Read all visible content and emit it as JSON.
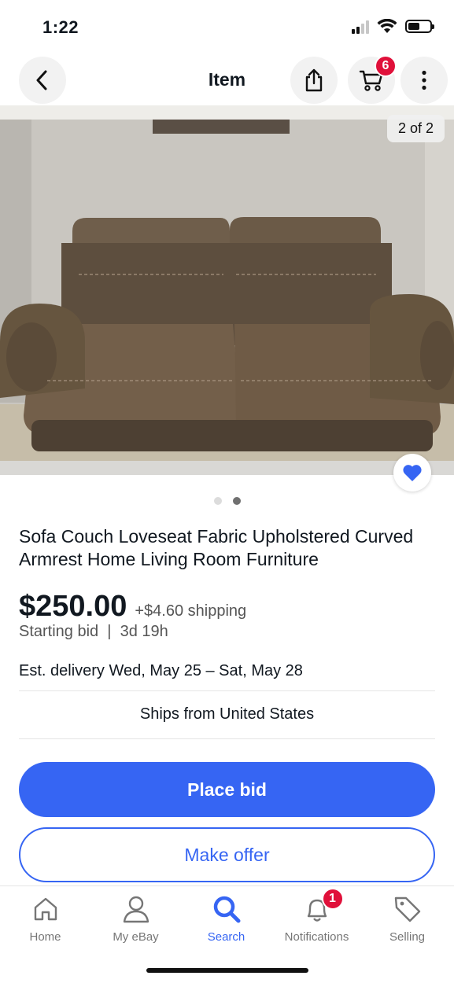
{
  "status_bar": {
    "time": "1:22"
  },
  "header": {
    "title": "Item",
    "cart_count": "6"
  },
  "gallery": {
    "counter": "2 of 2",
    "total_images": 2,
    "active_index": 2
  },
  "item": {
    "title": "Sofa Couch Loveseat Fabric Upholstered Curved Armrest Home Living Room Furniture",
    "price": "$250.00",
    "shipping": "+$4.60 shipping",
    "bid_info": "Starting bid  |  3d 19h",
    "delivery": "Est. delivery Wed, May 25 – Sat, May 28",
    "ships_from": "Ships from United States"
  },
  "actions": {
    "place_bid": "Place bid",
    "make_offer": "Make offer"
  },
  "bottom_nav": {
    "items": [
      {
        "label": "Home",
        "icon": "home-icon"
      },
      {
        "label": "My eBay",
        "icon": "person-icon"
      },
      {
        "label": "Search",
        "icon": "search-icon",
        "active": true
      },
      {
        "label": "Notifications",
        "icon": "bell-icon",
        "badge": "1"
      },
      {
        "label": "Selling",
        "icon": "tag-icon"
      }
    ]
  },
  "colors": {
    "accent": "#3665f3",
    "badge": "#e0103a",
    "text": "#111820",
    "muted": "#767676"
  }
}
